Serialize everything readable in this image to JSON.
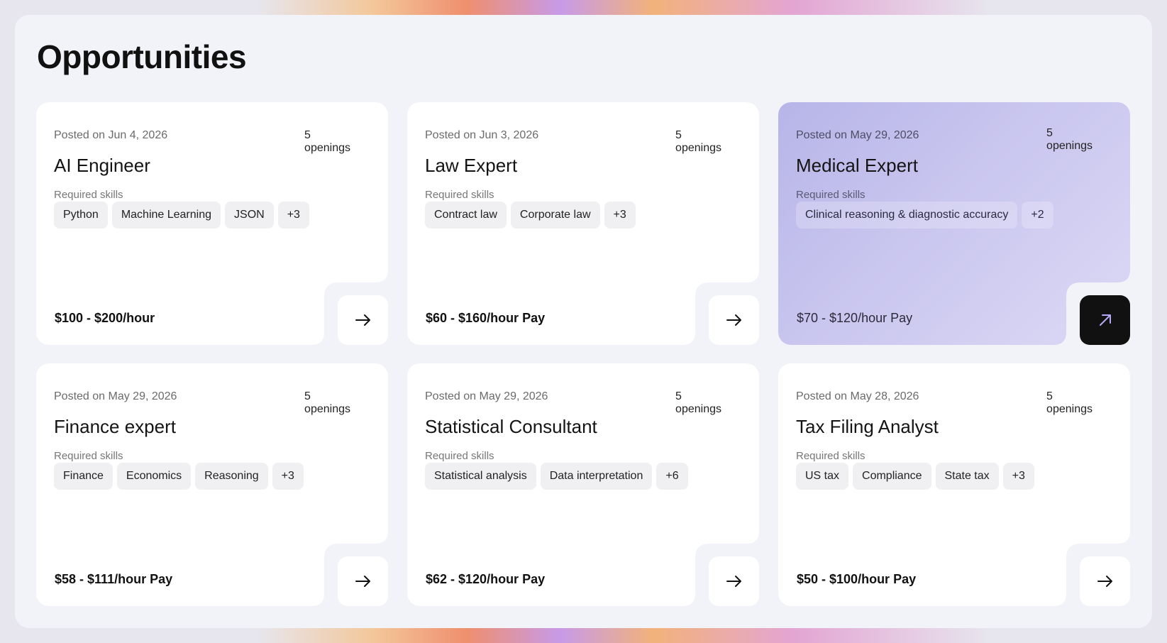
{
  "page": {
    "title": "Opportunities"
  },
  "cards": [
    {
      "posted": "Posted on Jun 4, 2026",
      "openings": "5 openings",
      "role": "AI Engineer",
      "skills_label": "Required skills",
      "skills": [
        "Python",
        "Machine Learning",
        "JSON",
        "+3"
      ],
      "pay": "$100 - $200/hour"
    },
    {
      "posted": "Posted on Jun 3, 2026",
      "openings": "5 openings",
      "role": "Law Expert",
      "skills_label": "Required skills",
      "skills": [
        "Contract law",
        "Corporate law",
        "+3"
      ],
      "pay": "$60 - $160/hour Pay"
    },
    {
      "posted": "Posted on May 29, 2026",
      "openings": "5 openings",
      "role": "Medical Expert",
      "skills_label": "Required skills",
      "skills": [
        "Clinical reasoning & diagnostic accuracy",
        "+2"
      ],
      "pay": "$70 - $120/hour Pay"
    },
    {
      "posted": "Posted on May 29, 2026",
      "openings": "5 openings",
      "role": "Finance expert",
      "skills_label": "Required skills",
      "skills": [
        "Finance",
        "Economics",
        "Reasoning",
        "+3"
      ],
      "pay": "$58 - $111/hour Pay"
    },
    {
      "posted": "Posted on May 29, 2026",
      "openings": "5 openings",
      "role": "Statistical Consultant",
      "skills_label": "Required skills",
      "skills": [
        "Statistical analysis",
        "Data interpretation",
        "+6"
      ],
      "pay": "$62 - $120/hour Pay"
    },
    {
      "posted": "Posted on May 28, 2026",
      "openings": "5 openings",
      "role": "Tax Filing Analyst",
      "skills_label": "Required skills",
      "skills": [
        "US tax",
        "Compliance",
        "State tax",
        "+3"
      ],
      "pay": "$50 - $100/hour Pay"
    }
  ],
  "icons": {
    "default_button": "arrow-right-icon",
    "active_button": "arrow-up-right-icon"
  },
  "colors": {
    "highlight_card": "#c4c1ee",
    "active_button": "#111111"
  }
}
